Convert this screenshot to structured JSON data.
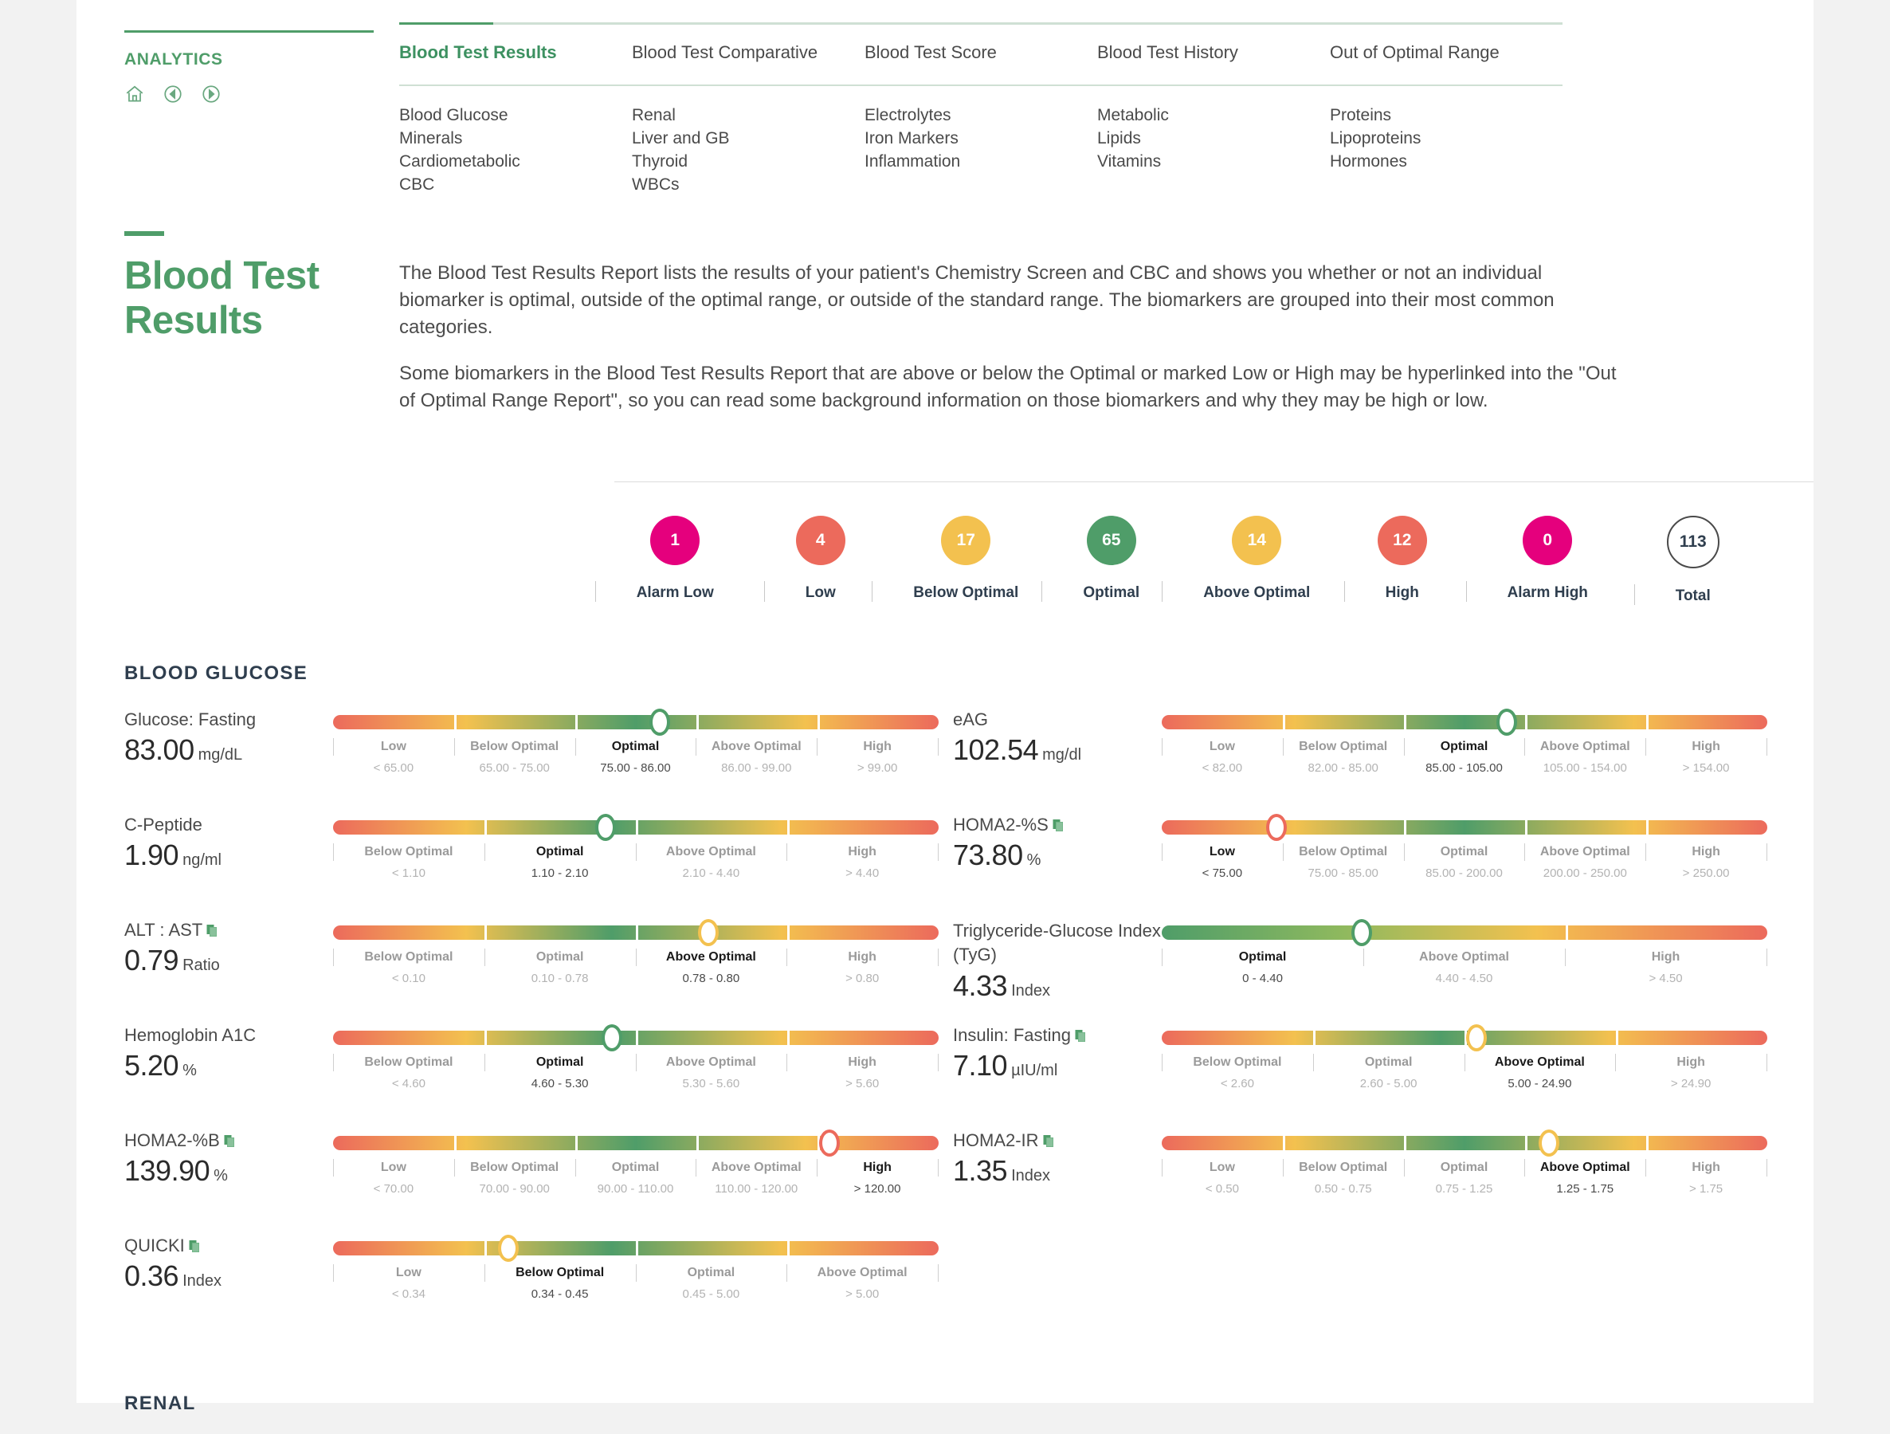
{
  "nav": {
    "analytics_label": "ANALYTICS",
    "icons": [
      "home-icon",
      "previous-icon",
      "next-icon"
    ],
    "primary": [
      {
        "label": "Blood Test Results",
        "active": true
      },
      {
        "label": "Blood Test Comparative",
        "active": false
      },
      {
        "label": "Blood Test Score",
        "active": false
      },
      {
        "label": "Blood Test History",
        "active": false
      },
      {
        "label": "Out of Optimal Range",
        "active": false
      }
    ],
    "categories": [
      [
        "Blood Glucose",
        "Minerals",
        "Cardiometabolic",
        "CBC"
      ],
      [
        "Renal",
        "Liver and GB",
        "Thyroid",
        "WBCs"
      ],
      [
        "Electrolytes",
        "Iron Markers",
        "Inflammation"
      ],
      [
        "Metabolic",
        "Lipids",
        "Vitamins"
      ],
      [
        "Proteins",
        "Lipoproteins",
        "Hormones"
      ]
    ]
  },
  "header": {
    "title": "Blood Test Results",
    "paragraphs": [
      "The Blood Test Results Report lists the results of your patient's Chemistry Screen and CBC and shows you whether or not an individual biomarker is optimal, outside of the optimal range, or outside of the standard range. The biomarkers are grouped into their most common categories.",
      "Some biomarkers in the Blood Test Results Report that are above or below the Optimal or marked Low or High may be hyperlinked into the \"Out of Optimal Range Report\", so you can read some background information on those biomarkers and why they may be high or low."
    ]
  },
  "summary": [
    {
      "count": "1",
      "label": "Alarm Low",
      "color": "#e5007d"
    },
    {
      "count": "4",
      "label": "Low",
      "color": "#ec6a5c"
    },
    {
      "count": "17",
      "label": "Below Optimal",
      "color": "#f5c council"
    },
    {
      "count": "65",
      "label": "Optimal",
      "color": "#4f9d69"
    },
    {
      "count": "14",
      "label": "Above Optimal",
      "color": "#f5c council"
    },
    {
      "count": "12",
      "label": "High",
      "color": "#ec6a5c"
    },
    {
      "count": "0",
      "label": "Alarm High",
      "color": "#e5007d"
    },
    {
      "count": "113",
      "label": "Total",
      "color": "#ffffff"
    }
  ],
  "sections": [
    {
      "title": "BLOOD GLUCOSE",
      "biomarkers": [
        {
          "name": "Glucose: Fasting",
          "linked": false,
          "value": "83.00",
          "unit": "mg/dL",
          "marker_pct": 54,
          "segments": [
            {
              "label": "Low",
              "range": "< 65.00",
              "active": false
            },
            {
              "label": "Below Optimal",
              "range": "65.00 - 75.00",
              "active": false
            },
            {
              "label": "Optimal",
              "range": "75.00 - 86.00",
              "active": true
            },
            {
              "label": "Above Optimal",
              "range": "86.00 - 99.00",
              "active": false
            },
            {
              "label": "High",
              "range": "> 99.00",
              "active": false
            }
          ]
        },
        {
          "name": "eAG",
          "linked": false,
          "value": "102.54",
          "unit": "mg/dl",
          "marker_pct": 57,
          "segments": [
            {
              "label": "Low",
              "range": "< 82.00",
              "active": false
            },
            {
              "label": "Below Optimal",
              "range": "82.00 - 85.00",
              "active": false
            },
            {
              "label": "Optimal",
              "range": "85.00 - 105.00",
              "active": true
            },
            {
              "label": "Above Optimal",
              "range": "105.00 - 154.00",
              "active": false
            },
            {
              "label": "High",
              "range": "> 154.00",
              "active": false
            }
          ]
        },
        {
          "name": "C-Peptide",
          "linked": false,
          "value": "1.90",
          "unit": "ng/ml",
          "marker_pct": 45,
          "segments": [
            {
              "label": "Below Optimal",
              "range": "< 1.10",
              "active": false
            },
            {
              "label": "Optimal",
              "range": "1.10 - 2.10",
              "active": true
            },
            {
              "label": "Above Optimal",
              "range": "2.10 - 4.40",
              "active": false
            },
            {
              "label": "High",
              "range": "> 4.40",
              "active": false
            }
          ]
        },
        {
          "name": "HOMA2-%S",
          "linked": true,
          "value": "73.80",
          "unit": "%",
          "marker_pct": 19,
          "marker_color": "#ec6a5c",
          "segments": [
            {
              "label": "Low",
              "range": "< 75.00",
              "active": true
            },
            {
              "label": "Below Optimal",
              "range": "75.00 - 85.00",
              "active": false
            },
            {
              "label": "Optimal",
              "range": "85.00 - 200.00",
              "active": false
            },
            {
              "label": "Above Optimal",
              "range": "200.00 - 250.00",
              "active": false
            },
            {
              "label": "High",
              "range": "> 250.00",
              "active": false
            }
          ]
        },
        {
          "name": "ALT : AST",
          "linked": true,
          "value": "0.79",
          "unit": "Ratio",
          "marker_pct": 62,
          "marker_color": "#f5c council",
          "segments": [
            {
              "label": "Below Optimal",
              "range": "< 0.10",
              "active": false
            },
            {
              "label": "Optimal",
              "range": "0.10 - 0.78",
              "active": false
            },
            {
              "label": "Above Optimal",
              "range": "0.78 - 0.80",
              "active": true
            },
            {
              "label": "High",
              "range": "> 0.80",
              "active": false
            }
          ]
        },
        {
          "name": "Triglyceride-Glucose Index (TyG)",
          "linked": false,
          "value": "4.33",
          "unit": "Index",
          "marker_pct": 33,
          "segments": [
            {
              "label": "Optimal",
              "range": "0 - 4.40",
              "active": true
            },
            {
              "label": "Above Optimal",
              "range": "4.40 - 4.50",
              "active": false
            },
            {
              "label": "High",
              "range": "> 4.50",
              "active": false
            }
          ]
        },
        {
          "name": "Hemoglobin A1C",
          "linked": false,
          "value": "5.20",
          "unit": "%",
          "marker_pct": 46,
          "segments": [
            {
              "label": "Below Optimal",
              "range": "< 4.60",
              "active": false
            },
            {
              "label": "Optimal",
              "range": "4.60 - 5.30",
              "active": true
            },
            {
              "label": "Above Optimal",
              "range": "5.30 - 5.60",
              "active": false
            },
            {
              "label": "High",
              "range": "> 5.60",
              "active": false
            }
          ]
        },
        {
          "name": "Insulin: Fasting",
          "linked": true,
          "value": "7.10",
          "unit": "µIU/ml",
          "marker_pct": 52,
          "marker_color": "#f5c council",
          "segments": [
            {
              "label": "Below Optimal",
              "range": "< 2.60",
              "active": false
            },
            {
              "label": "Optimal",
              "range": "2.60 - 5.00",
              "active": false
            },
            {
              "label": "Above Optimal",
              "range": "5.00 - 24.90",
              "active": true
            },
            {
              "label": "High",
              "range": "> 24.90",
              "active": false
            }
          ]
        },
        {
          "name": "HOMA2-%B",
          "linked": true,
          "value": "139.90",
          "unit": "%",
          "marker_pct": 82,
          "marker_color": "#ec6a5c",
          "segments": [
            {
              "label": "Low",
              "range": "< 70.00",
              "active": false
            },
            {
              "label": "Below Optimal",
              "range": "70.00 - 90.00",
              "active": false
            },
            {
              "label": "Optimal",
              "range": "90.00 - 110.00",
              "active": false
            },
            {
              "label": "Above Optimal",
              "range": "110.00 - 120.00",
              "active": false
            },
            {
              "label": "High",
              "range": "> 120.00",
              "active": true
            }
          ]
        },
        {
          "name": "HOMA2-IR",
          "linked": true,
          "value": "1.35",
          "unit": "Index",
          "marker_pct": 64,
          "marker_color": "#f5c council",
          "segments": [
            {
              "label": "Low",
              "range": "< 0.50",
              "active": false
            },
            {
              "label": "Below Optimal",
              "range": "0.50 - 0.75",
              "active": false
            },
            {
              "label": "Optimal",
              "range": "0.75 - 1.25",
              "active": false
            },
            {
              "label": "Above Optimal",
              "range": "1.25 - 1.75",
              "active": true
            },
            {
              "label": "High",
              "range": "> 1.75",
              "active": false
            }
          ]
        },
        {
          "name": "QUICKI",
          "linked": true,
          "value": "0.36",
          "unit": "Index",
          "marker_pct": 29,
          "marker_color": "#f5c council",
          "segments": [
            {
              "label": "Low",
              "range": "< 0.34",
              "active": false
            },
            {
              "label": "Below Optimal",
              "range": "0.34 - 0.45",
              "active": true
            },
            {
              "label": "Optimal",
              "range": "0.45 - 5.00",
              "active": false
            },
            {
              "label": "Above Optimal",
              "range": "> 5.00",
              "active": false
            }
          ]
        }
      ]
    },
    {
      "title": "RENAL",
      "biomarkers": []
    }
  ]
}
